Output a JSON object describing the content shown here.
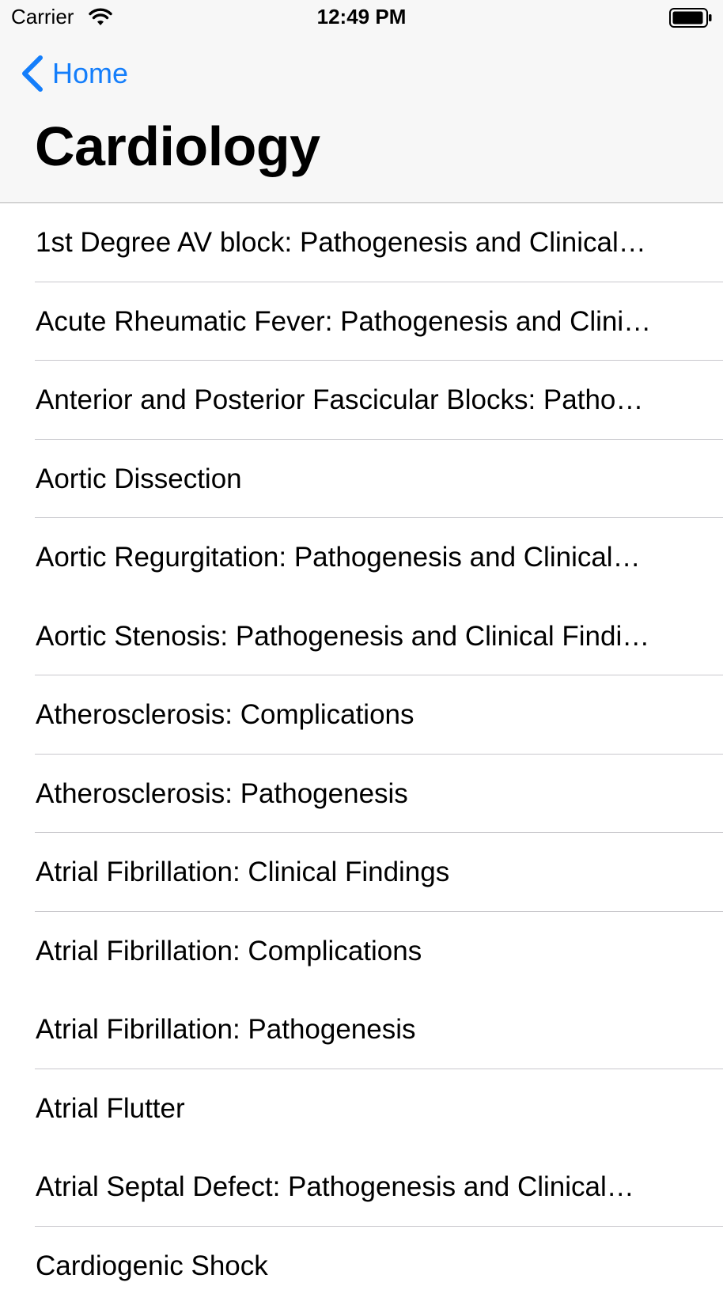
{
  "status_bar": {
    "carrier": "Carrier",
    "time": "12:49 PM"
  },
  "nav": {
    "back_label": "Home",
    "title": "Cardiology"
  },
  "colors": {
    "accent": "#147efb",
    "header_background": "#f7f7f7",
    "separator": "#c8c7cc"
  },
  "icons": {
    "back": "chevron-left-icon",
    "wifi": "wifi-icon",
    "battery": "battery-icon"
  },
  "topics": [
    {
      "label": "1st Degree AV block: Pathogenesis and Clinical…"
    },
    {
      "label": "Acute Rheumatic Fever: Pathogenesis and Clini…"
    },
    {
      "label": "Anterior and Posterior Fascicular Blocks: Patho…"
    },
    {
      "label": "Aortic Dissection"
    },
    {
      "label": "Aortic Regurgitation: Pathogenesis and Clinical…"
    },
    {
      "label": "Aortic Stenosis: Pathogenesis and Clinical Findi…"
    },
    {
      "label": "Atherosclerosis: Complications"
    },
    {
      "label": "Atherosclerosis: Pathogenesis"
    },
    {
      "label": "Atrial Fibrillation: Clinical Findings"
    },
    {
      "label": "Atrial Fibrillation: Complications"
    },
    {
      "label": "Atrial Fibrillation: Pathogenesis"
    },
    {
      "label": "Atrial Flutter"
    },
    {
      "label": "Atrial Septal Defect: Pathogenesis and Clinical…"
    },
    {
      "label": "Cardiogenic Shock"
    }
  ]
}
